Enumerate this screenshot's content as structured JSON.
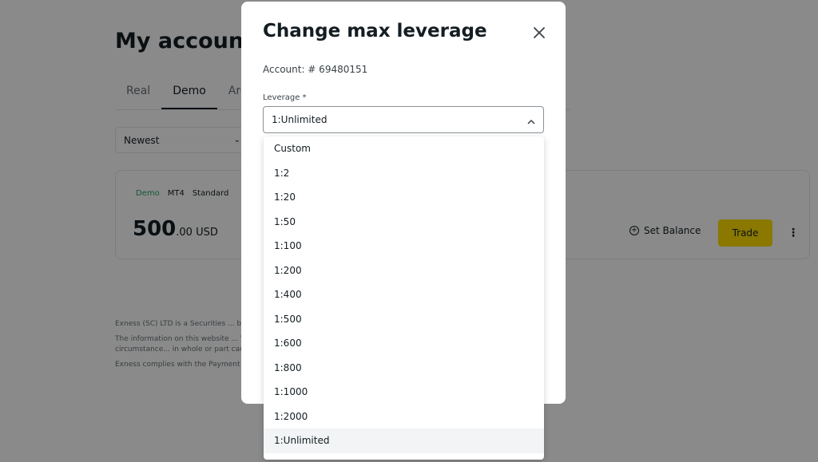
{
  "page": {
    "title": "My account",
    "tabs": [
      {
        "label": "Real",
        "active": false
      },
      {
        "label": "Demo",
        "active": true
      },
      {
        "label": "Arch",
        "active": false
      }
    ],
    "sort": {
      "value": "Newest"
    },
    "account_card": {
      "badges": [
        "Demo",
        "MT4",
        "Standard"
      ],
      "balance_int": "500",
      "balance_dec": ".00 USD",
      "set_balance_label": "Set Balance",
      "trade_label": "Trade"
    },
    "footer": [
      "Exness (SC) LTD is a Securities ... by the Financial Services Autho... 9A CT House, 2nd floor, Provide...",
      "The information on this website ... Warning: CFDs are leveraged pr... all investors. The investment va... capital. Under no circumstance... in whole or part caused by resulting...",
      "Exness complies with the Payment C... privacy. We conduct regular vulnerab... for our business model."
    ]
  },
  "modal": {
    "title": "Change max leverage",
    "account_line": "Account: # 69480151",
    "field_label": "Leverage *",
    "selected_value": "1:Unlimited",
    "options": [
      "Custom",
      "1:2",
      "1:20",
      "1:50",
      "1:100",
      "1:200",
      "1:400",
      "1:500",
      "1:600",
      "1:800",
      "1:1000",
      "1:2000",
      "1:Unlimited"
    ]
  },
  "colors": {
    "accent": "#ffde02",
    "demo_badge": "#25a567",
    "overlay": "rgba(0,0,0,0.46)"
  }
}
